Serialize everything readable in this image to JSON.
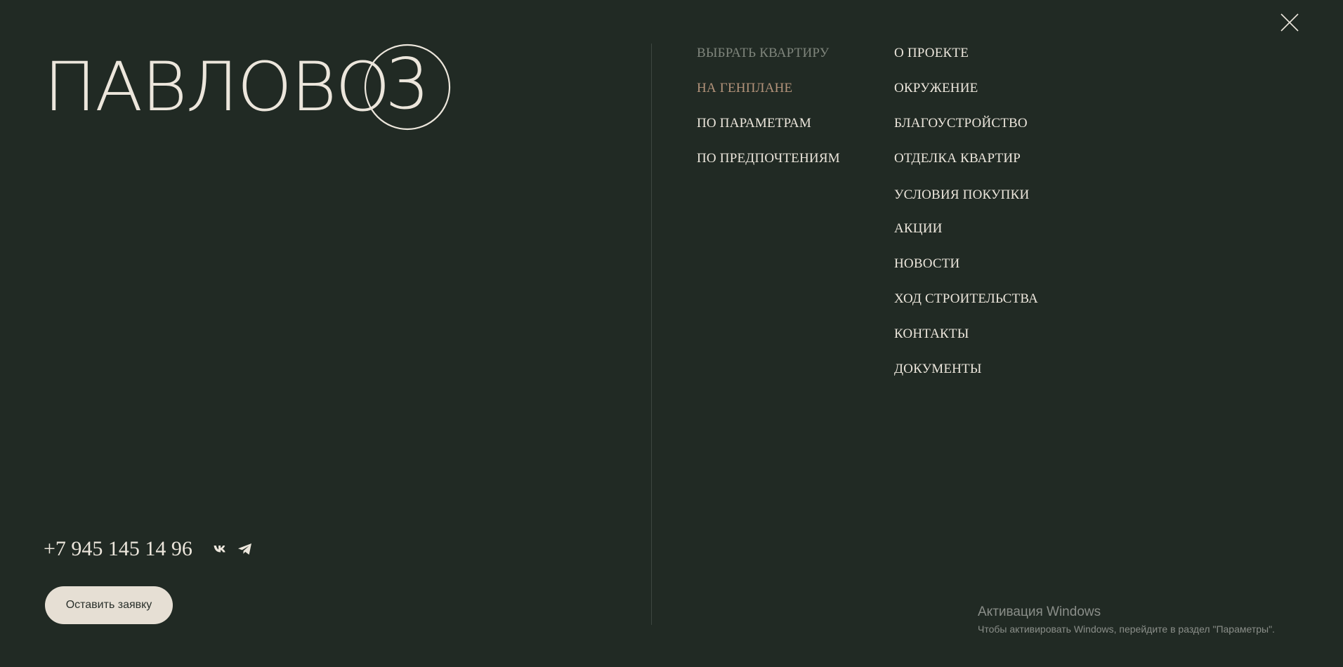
{
  "logo": {
    "text": "ПАВЛОВО",
    "number": "3"
  },
  "close": {
    "icon": "close-icon"
  },
  "menu": {
    "column1": [
      {
        "label": "ВЫБРАТЬ КВАРТИРУ",
        "state": "muted"
      },
      {
        "label": "НА ГЕНПЛАНЕ",
        "state": "active"
      },
      {
        "label": "ПО ПАРАМЕТРАМ",
        "state": "normal"
      },
      {
        "label": "ПО ПРЕДПОЧТЕНИЯМ",
        "state": "normal"
      }
    ],
    "column2": [
      {
        "label": "О ПРОЕКТЕ"
      },
      {
        "label": "ОКРУЖЕНИЕ"
      },
      {
        "label": "БЛАГОУСТРОЙСТВО"
      },
      {
        "label": "ОТДЕЛКА КВАРТИР"
      },
      {
        "label": "УСЛОВИЯ ПОКУПКИ"
      },
      {
        "label": "АКЦИИ"
      },
      {
        "label": "НОВОСТИ"
      },
      {
        "label": "ХОД СТРОИТЕЛЬСТВА"
      },
      {
        "label": "КОНТАКТЫ"
      },
      {
        "label": "ДОКУМЕНТЫ"
      }
    ]
  },
  "contacts": {
    "phone": "+7 945 145 14 96",
    "socials": [
      "vk-icon",
      "telegram-icon"
    ]
  },
  "cta": {
    "label": "Оставить заявку"
  },
  "windows_activation": {
    "title": "Активация Windows",
    "subtitle": "Чтобы активировать Windows, перейдите в раздел \"Параметры\"."
  },
  "colors": {
    "background": "#212a24",
    "text": "#ece6dc",
    "muted": "#7f857c",
    "accent": "#b3937a",
    "button_bg": "#e6dfd4"
  }
}
